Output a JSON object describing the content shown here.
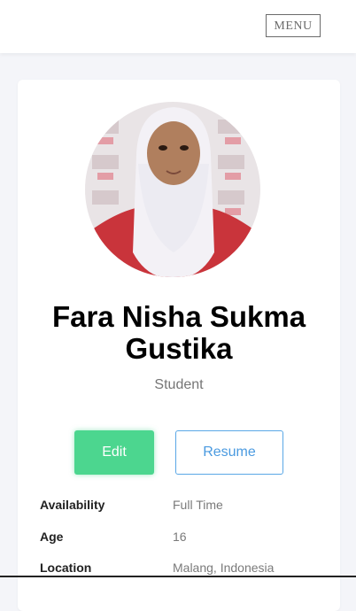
{
  "header": {
    "menu_label": "MENU"
  },
  "profile": {
    "avatar_icon": "profile-photo",
    "name": "Fara Nisha Sukma Gustika",
    "role": "Student"
  },
  "actions": {
    "edit_label": "Edit",
    "resume_label": "Resume"
  },
  "details": [
    {
      "label": "Availability",
      "value": "Full Time"
    },
    {
      "label": "Age",
      "value": "16"
    },
    {
      "label": "Location",
      "value": "Malang, Indonesia"
    }
  ],
  "colors": {
    "edit_button": "#4cd68f",
    "resume_border": "#5aa7e6",
    "background": "#f4f5f9"
  }
}
